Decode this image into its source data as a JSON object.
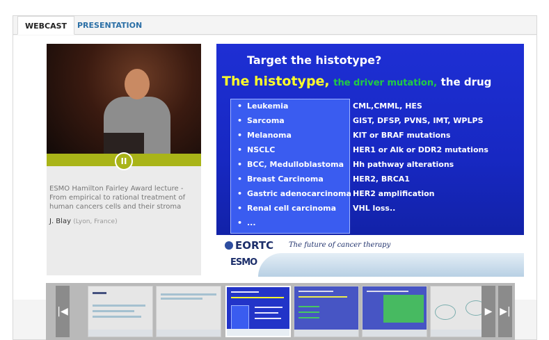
{
  "tabs": [
    {
      "label": "WEBCAST",
      "active": true
    },
    {
      "label": "PRESENTATION",
      "active": false
    }
  ],
  "player": {
    "pause_label": "II",
    "state": "playing"
  },
  "lecture": {
    "title": "ESMO Hamilton Fairley Award lecture - From empirical to rational treatment of human cancers cells and their stroma",
    "speaker": "J. Blay",
    "location": "(Lyon, France)"
  },
  "slide": {
    "title": "Target the histotype?",
    "headline_part1": "The histotype,",
    "headline_part2": "the driver mutation,",
    "headline_part3": "the drug",
    "rows": [
      {
        "disease": "Leukemia",
        "mutation": "CML,CMML, HES"
      },
      {
        "disease": "Sarcoma",
        "mutation": "GIST, DFSP, PVNS, IMT, WPLPS"
      },
      {
        "disease": "Melanoma",
        "mutation": "KIT or BRAF mutations"
      },
      {
        "disease": "NSCLC",
        "mutation": "HER1 or Alk or DDR2 mutations"
      },
      {
        "disease": "BCC, Medulloblastoma",
        "mutation": "Hh pathway alterations"
      },
      {
        "disease": "Breast Carcinoma",
        "mutation": "HER2, BRCA1"
      },
      {
        "disease": "Gastric adenocarcinoma",
        "mutation": "HER2 amplification"
      },
      {
        "disease": "Renal cell carcinoma",
        "mutation": "VHL loss.."
      },
      {
        "disease": "...",
        "mutation": ""
      }
    ],
    "bullet": "•",
    "footer": {
      "org": "EORTC",
      "tagline": "The future of cancer therapy",
      "esmo": "ESMO"
    }
  },
  "thumbnails": {
    "prev_label": "|◀",
    "next_label": "▶",
    "last_label": "▶|"
  },
  "colors": {
    "tab_active_text": "#222222",
    "tab_link": "#2b6fa6",
    "player_accent": "#a9b418",
    "slide_blue": "#1e2fd4",
    "slide_yellow": "#ffff2a",
    "slide_green": "#22cc44"
  }
}
